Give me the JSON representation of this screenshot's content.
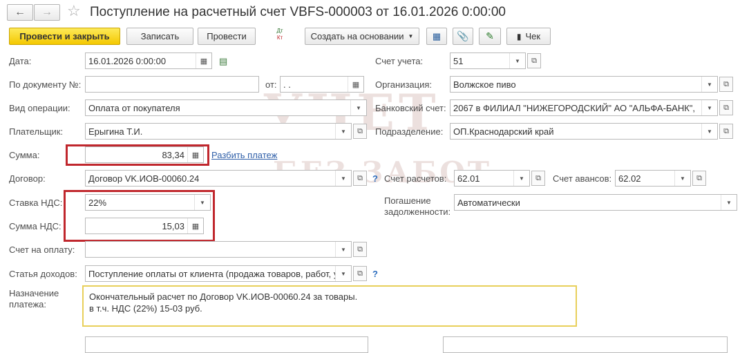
{
  "window": {
    "title": "Поступление на расчетный счет VBFS-000003 от 16.01.2026 0:00:00"
  },
  "toolbar": {
    "post_close": "Провести и закрыть",
    "save": "Записать",
    "post": "Провести",
    "dtkt_top": "Дт",
    "dtkt_bottom": "Кт",
    "create_based": "Создать на основании",
    "check": "Чек"
  },
  "form": {
    "date_label": "Дата:",
    "date_value": "16.01.2026  0:00:00",
    "doc_no_label": "По документу №:",
    "doc_no_value": "",
    "from_label": "от:",
    "from_value": " .  .",
    "operation_label": "Вид операции:",
    "operation_value": "Оплата от покупателя",
    "payer_label": "Плательщик:",
    "payer_value": "Ерыгина Т.И.",
    "sum_label": "Сумма:",
    "sum_value": "83,34",
    "split_link": "Разбить платеж",
    "contract_label": "Договор:",
    "contract_value": "Договор VK.ИОВ-00060.24",
    "contract_help": "?",
    "vat_rate_label": "Ставка НДС:",
    "vat_rate_value": "22%",
    "vat_sum_label": "Сумма НДС:",
    "vat_sum_value": "15,03",
    "invoice_label": "Счет на оплату:",
    "invoice_value": "",
    "income_label": "Статья доходов:",
    "income_value": "Поступление оплаты от клиента (продажа товаров, работ, ус",
    "income_help": "?",
    "purpose_label_1": "Назначение",
    "purpose_label_2": "платежа:",
    "purpose_line1": "Окончательный расчет по Договор VK.ИОВ-00060.24 за товары.",
    "purpose_line2": "в т.ч. НДС (22%) 15-03 руб.",
    "account_label": "Счет учета:",
    "account_value": "51",
    "org_label": "Организация:",
    "org_value": "Волжское пиво",
    "bank_label": "Банковский счет:",
    "bank_value": "2067 в ФИЛИАЛ \"НИЖЕГОРОДСКИЙ\" АО \"АЛЬФА-БАНК\",",
    "dept_label": "Подразделение:",
    "dept_value": "ОП.Краснодарский край",
    "calc_acc_label": "Счет расчетов:",
    "calc_acc_value": "62.01",
    "adv_acc_label": "Счет авансов:",
    "adv_acc_value": "62.02",
    "debt_label_1": "Погашение",
    "debt_label_2": "задолженности:",
    "debt_value": "Автоматически"
  },
  "watermark": {
    "line1": "УЧЕТ",
    "line2": "БЕЗ ЗАБОТ"
  },
  "colors": {
    "primary": "#f4c800",
    "highlight": "#c0272d",
    "link": "#2f5fa8"
  }
}
